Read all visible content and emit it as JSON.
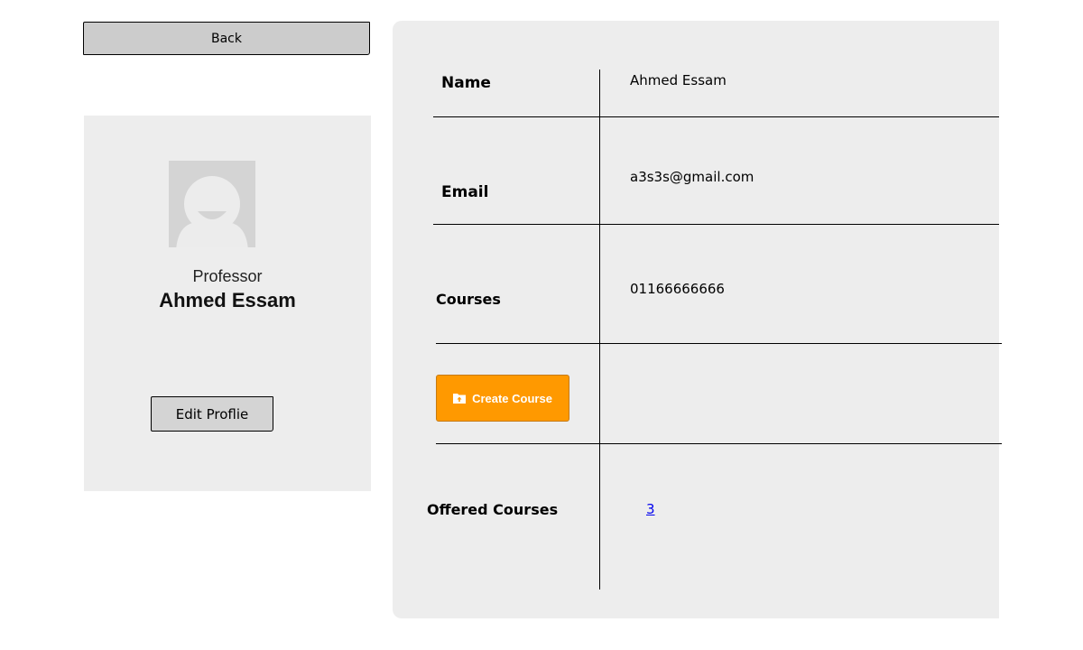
{
  "back_button": {
    "label": "Back"
  },
  "profile": {
    "role": "Professor",
    "name": "Ahmed Essam",
    "edit_label": "Edit Proflie",
    "avatar_icon": "user-avatar-icon"
  },
  "details": {
    "name": {
      "label": "Name",
      "value": "Ahmed Essam"
    },
    "email": {
      "label": "Email",
      "value": "a3s3s@gmail.com"
    },
    "courses": {
      "label": "Courses",
      "value": "01166666666"
    },
    "create_course": {
      "label": "Create Course",
      "icon": "folder-upload-icon",
      "color": "#ff9900"
    },
    "offered_courses": {
      "label": "Offered Courses",
      "value": "3"
    }
  }
}
